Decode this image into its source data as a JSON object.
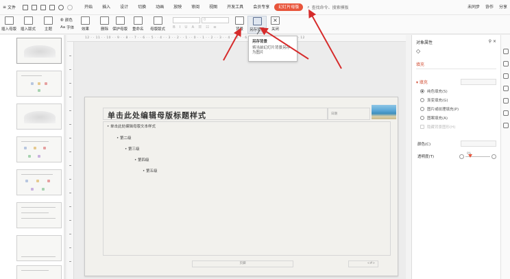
{
  "menubar": {
    "file_label": "文件",
    "tabs": [
      "开始",
      "插入",
      "设计",
      "切换",
      "动画",
      "放映",
      "审阅",
      "视图",
      "开发工具",
      "会员专享"
    ],
    "active_tab": "幻灯片母版",
    "search_placeholder": "查找命令、搜索模板",
    "right": [
      "未同步",
      "协作",
      "分享"
    ]
  },
  "ribbon": {
    "insert_master": "插入母版",
    "insert_layout": "插入版式",
    "theme": "主题",
    "color": "颜色",
    "font": "字体",
    "effects": "效果",
    "delete": "删除",
    "protect_master": "保护母版",
    "rename": "重命名",
    "master_layout": "母版版式",
    "font_size_value": "0",
    "background": "背景",
    "save_background": "另存背景",
    "close": "关闭"
  },
  "tooltip": {
    "title": "另存背景",
    "description": "将当前幻灯片背景另存为图片"
  },
  "ruler": {
    "ticks": "12 · · 11 · · 10 · · 9 · · 8 · · 7 · · 6 · · 5 · · 4 · · 3 · · 2 · · 1 · · 0 · · 1 · · 2 · · 3 · · 4 · · 5 · · 6 · · 7 · · 8 · · 9 · · 10 · · 11 · · 12"
  },
  "slide": {
    "title": "单击此处编辑母版标题样式",
    "date": "日期",
    "level1": "• 单击此处编辑母版文本样式",
    "level2": "• 第二级",
    "level3": "• 第三级",
    "level4": "• 第四级",
    "level5": "• 第五级",
    "footer": "页脚",
    "page_num": "<#>"
  },
  "props": {
    "title": "对象属性",
    "subtab": "填充",
    "section": "填充",
    "options": [
      "纯色填充(S)",
      "渐变填充(G)",
      "图片或纹理填充(P)",
      "图案填充(A)"
    ],
    "hide_bg": "隐藏背景图形(H)",
    "color_label": "颜色(C)",
    "transparency_label": "透明度(T)",
    "transparency_value": "0%"
  },
  "colors": {
    "accent": "#e8553b",
    "slide_bg": "#f2f1ed",
    "arrow": "#d62b2b"
  }
}
